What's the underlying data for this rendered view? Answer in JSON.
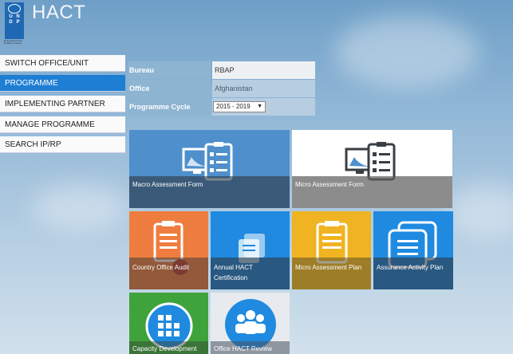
{
  "header": {
    "title": "HACT",
    "logo_text": "UNDP",
    "logo_subtitle": "Empowered lives. Resilient nations."
  },
  "sidebar": {
    "items": [
      {
        "label": "SWITCH OFFICE/UNIT"
      },
      {
        "label": "PROGRAMME",
        "active": true
      },
      {
        "label": "IMPLEMENTING PARTNER"
      },
      {
        "label": "MANAGE PROGRAMME"
      },
      {
        "label": "SEARCH IP/RP"
      }
    ]
  },
  "info": {
    "bureau_label": "Bureau",
    "bureau_value": "RBAP",
    "office_label": "Office",
    "office_value": "Afghanistan",
    "cycle_label": "Programme Cycle",
    "cycle_value": "2015 - 2019"
  },
  "tiles": {
    "macro": {
      "label": "Macro Assessment Form",
      "color": "#4e8fcc"
    },
    "micro": {
      "label": "Micro Assessment Form",
      "color": "#ffffff"
    },
    "audit": {
      "label": "Country Office Audit",
      "color": "#ef7d3f"
    },
    "annual": {
      "line1": "Annual HACT",
      "line2": "Certification",
      "color": "#1f8ae0"
    },
    "plan": {
      "label": "Micro Assessment Plan",
      "color": "#f0b321"
    },
    "assurance": {
      "label": "Assurance Activity Plan",
      "color": "#1f8ae0"
    },
    "capacity": {
      "label": "Capacity Development",
      "color": "#3fa33b"
    },
    "review": {
      "label": "Office HACT Review",
      "color": "#ffffff"
    }
  },
  "icons": [
    "clipboard-icon",
    "monitor-icon",
    "certificate-icon",
    "people-icon",
    "grid-icon"
  ]
}
